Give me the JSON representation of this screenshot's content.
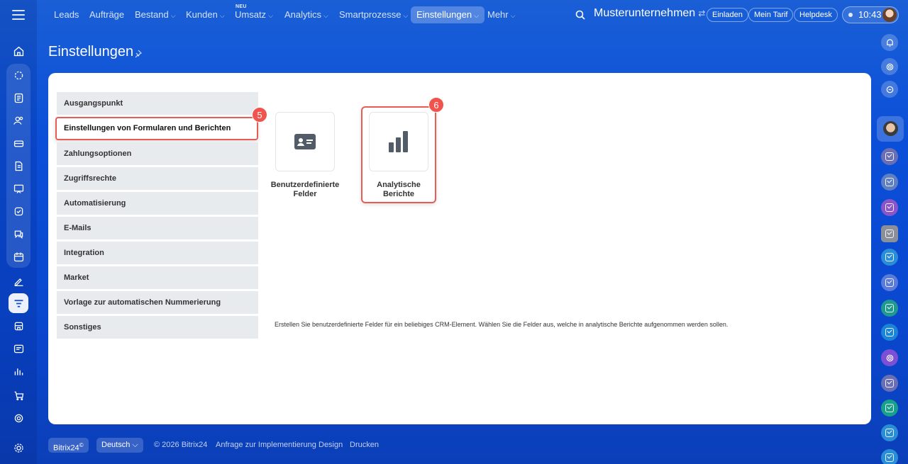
{
  "nav": {
    "items": [
      {
        "label": "Leads",
        "chevron": false
      },
      {
        "label": "Aufträge",
        "chevron": false
      },
      {
        "label": "Bestand",
        "chevron": true
      },
      {
        "label": "Kunden",
        "chevron": true
      },
      {
        "label": "Umsatz",
        "chevron": true,
        "badge": "NEU"
      },
      {
        "label": "Analytics",
        "chevron": true
      },
      {
        "label": "Smartprozesse",
        "chevron": true
      },
      {
        "label": "Einstellungen",
        "chevron": true,
        "active": true
      },
      {
        "label": "Mehr",
        "chevron": true
      }
    ],
    "company": "Musterunternehmen",
    "invite": "Einladen",
    "tariff": "Mein Tarif",
    "helpdesk": "Helpdesk",
    "time": "10:43"
  },
  "page": {
    "title": "Einstellungen"
  },
  "settings_menu": [
    {
      "label": "Ausgangspunkt"
    },
    {
      "label": "Einstellungen von Formularen und Berichten",
      "selected": true
    },
    {
      "label": "Zahlungsoptionen"
    },
    {
      "label": "Zugriffsrechte"
    },
    {
      "label": "Automatisierung"
    },
    {
      "label": "E-Mails"
    },
    {
      "label": "Integration"
    },
    {
      "label": "Market"
    },
    {
      "label": "Vorlage zur automatischen Nummerierung"
    },
    {
      "label": "Sonstiges"
    }
  ],
  "markers": {
    "step5": "5",
    "step6": "6"
  },
  "tiles": [
    {
      "label_line1": "Benutzerdefinierte",
      "label_line2": "Felder",
      "icon": "id-card-icon"
    },
    {
      "label_line1": "Analytische",
      "label_line2": "Berichte",
      "icon": "bar-chart-icon"
    }
  ],
  "description": "Erstellen Sie benutzerdefinierte Felder für ein beliebiges CRM-Element. Wählen Sie die Felder aus, welche in analytische Berichte aufgenommen werden sollen.",
  "footer": {
    "brand": "Bitrix24",
    "brand_mark": "©",
    "language": "Deutsch",
    "copyright": "© 2026 Bitrix24",
    "links": [
      "Anfrage zur Implementierung",
      "Design",
      "Drucken"
    ]
  },
  "colors": {
    "accent_red": "#f0544c",
    "menu_bg": "#e8ebee",
    "brand_blue": "#0b4fd8"
  }
}
